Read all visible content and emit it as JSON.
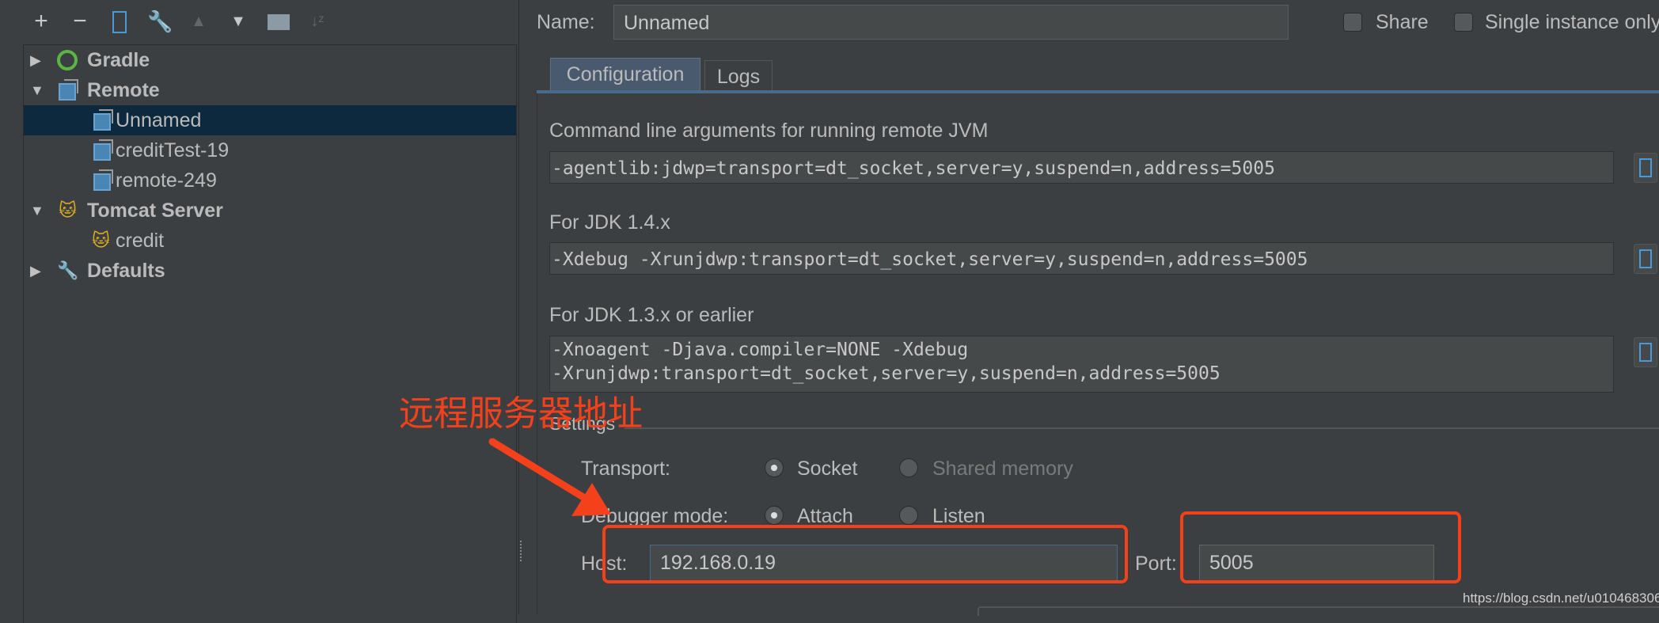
{
  "toolbar": {
    "icons": [
      "plus-icon",
      "minus-icon",
      "copy-icon",
      "wrench-icon",
      "move-up-icon",
      "move-down-icon",
      "folder-icon",
      "sort-icon"
    ],
    "plus": "+",
    "minus": "−"
  },
  "tree": {
    "items": [
      {
        "label": "Gradle",
        "level": 0,
        "expanded": false,
        "icon": "gradle-icon",
        "selected": false
      },
      {
        "label": "Remote",
        "level": 0,
        "expanded": true,
        "icon": "remote-icon",
        "selected": false
      },
      {
        "label": "Unnamed",
        "level": 1,
        "icon": "remote-icon",
        "selected": true
      },
      {
        "label": "creditTest-19",
        "level": 1,
        "icon": "remote-icon",
        "selected": false
      },
      {
        "label": "remote-249",
        "level": 1,
        "icon": "remote-icon",
        "selected": false
      },
      {
        "label": "Tomcat Server",
        "level": 0,
        "expanded": true,
        "icon": "tomcat-icon",
        "selected": false
      },
      {
        "label": "credit",
        "level": 1,
        "icon": "tomcat-icon",
        "selected": false
      },
      {
        "label": "Defaults",
        "level": 0,
        "expanded": false,
        "icon": "wrench-icon",
        "selected": false
      }
    ]
  },
  "header": {
    "name_label": "Name:",
    "name_value": "Unnamed",
    "share_label": "Share",
    "share_checked": false,
    "single_instance_label": "Single instance only",
    "single_instance_checked": false
  },
  "tabs": [
    {
      "label": "Configuration",
      "active": true
    },
    {
      "label": "Logs",
      "active": false
    }
  ],
  "config": {
    "cmd_label": "Command line arguments for running remote JVM",
    "cmd_value": "-agentlib:jdwp=transport=dt_socket,server=y,suspend=n,address=5005",
    "jdk14_label": "For JDK 1.4.x",
    "jdk14_value": "-Xdebug -Xrunjdwp:transport=dt_socket,server=y,suspend=n,address=5005",
    "jdk13_label": "For JDK 1.3.x or earlier",
    "jdk13_value_line1": "-Xnoagent -Djava.compiler=NONE -Xdebug",
    "jdk13_value_line2": "-Xrunjdwp:transport=dt_socket,server=y,suspend=n,address=5005"
  },
  "settings": {
    "title": "Settings",
    "transport_label": "Transport:",
    "transport_options": [
      "Socket",
      "Shared memory"
    ],
    "transport_selected": "Socket",
    "mode_label": "Debugger mode:",
    "mode_options": [
      "Attach",
      "Listen"
    ],
    "mode_selected": "Attach",
    "host_label": "Host:",
    "host_value": "192.168.0.19",
    "port_label": "Port:",
    "port_value": "5005"
  },
  "annotation": {
    "text": "远程服务器地址",
    "color": "#f5401c"
  },
  "watermark": "https://blog.csdn.net/u010468306",
  "colors": {
    "background": "#3c3f41",
    "selection": "#0d293e",
    "field": "#45494a",
    "accent_tab": "#4a6a8a"
  }
}
